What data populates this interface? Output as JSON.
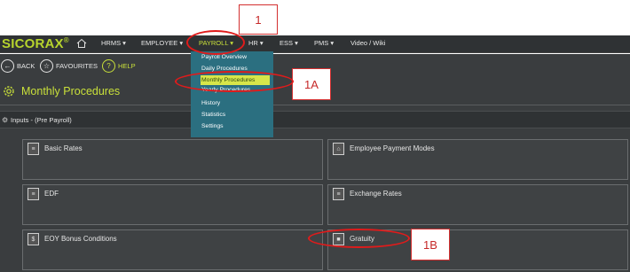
{
  "annotations": {
    "label_1": "1",
    "label_1a": "1A",
    "label_1b": "1B"
  },
  "header": {
    "logo": "SICORAX",
    "logo_mark": "®",
    "nav": [
      {
        "label": "HRMS ▾"
      },
      {
        "label": "EMPLOYEE ▾"
      },
      {
        "label": "PAYROLL ▾"
      },
      {
        "label": "HR ▾"
      },
      {
        "label": "ESS ▾"
      },
      {
        "label": "PMS ▾"
      },
      {
        "label": "Video / Wiki"
      }
    ]
  },
  "toolbar": {
    "back": "BACK",
    "favourites": "FAVOURITES",
    "help": "HELP"
  },
  "page": {
    "title": "Monthly Procedures"
  },
  "section": {
    "title": "Inputs - (Pre Payroll)"
  },
  "tiles": [
    {
      "label": "Basic Rates"
    },
    {
      "label": "Employee Payment Modes"
    },
    {
      "label": "EDF"
    },
    {
      "label": "Exchange Rates"
    },
    {
      "label": "EOY Bonus Conditions"
    },
    {
      "label": "Gratuity"
    }
  ],
  "payroll_menu": [
    {
      "label": "Payroll Overview"
    },
    {
      "label": "Daily Procedures"
    },
    {
      "label": "Monthly Procedures"
    },
    {
      "label": "Yearly Procedures"
    },
    {
      "label": "History"
    },
    {
      "label": "Statistics"
    },
    {
      "label": "Settings"
    }
  ],
  "colors": {
    "accent": "#c9e03a",
    "menu_bg": "#2b6f80",
    "annotation": "#e01b1b",
    "panel": "#3a3d3f"
  }
}
